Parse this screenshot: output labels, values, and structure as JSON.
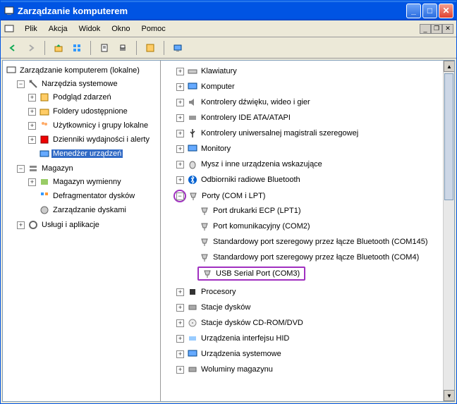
{
  "window": {
    "title": "Zarządzanie komputerem"
  },
  "menubar": {
    "items": [
      "Plik",
      "Akcja",
      "Widok",
      "Okno",
      "Pomoc"
    ]
  },
  "left_tree": {
    "root": "Zarządzanie komputerem (lokalne)",
    "tools": {
      "label": "Narzędzia systemowe",
      "children": [
        "Podgląd zdarzeń",
        "Foldery udostępnione",
        "Użytkownicy i grupy lokalne",
        "Dzienniki wydajności i alerty",
        "Menedżer urządzeń"
      ]
    },
    "storage": {
      "label": "Magazyn",
      "children": [
        "Magazyn wymienny",
        "Defragmentator dysków",
        "Zarządzanie dyskami"
      ]
    },
    "services": {
      "label": "Usługi i aplikacje"
    }
  },
  "right_tree": {
    "items": [
      "Klawiatury",
      "Komputer",
      "Kontrolery dźwięku, wideo i gier",
      "Kontrolery IDE ATA/ATAPI",
      "Kontrolery uniwersalnej magistrali szeregowej",
      "Monitory",
      "Mysz i inne urządzenia wskazujące",
      "Odbiorniki radiowe Bluetooth"
    ],
    "ports": {
      "label": "Porty (COM i LPT)",
      "children": [
        "Port drukarki ECP (LPT1)",
        "Port komunikacyjny (COM2)",
        "Standardowy port szeregowy przez łącze Bluetooth (COM145)",
        "Standardowy port szeregowy przez łącze Bluetooth (COM4)",
        "USB Serial Port (COM3)"
      ]
    },
    "items_after": [
      "Procesory",
      "Stacje dysków",
      "Stacje dysków CD-ROM/DVD",
      "Urządzenia interfejsu HID",
      "Urządzenia systemowe",
      "Woluminy magazynu"
    ]
  }
}
